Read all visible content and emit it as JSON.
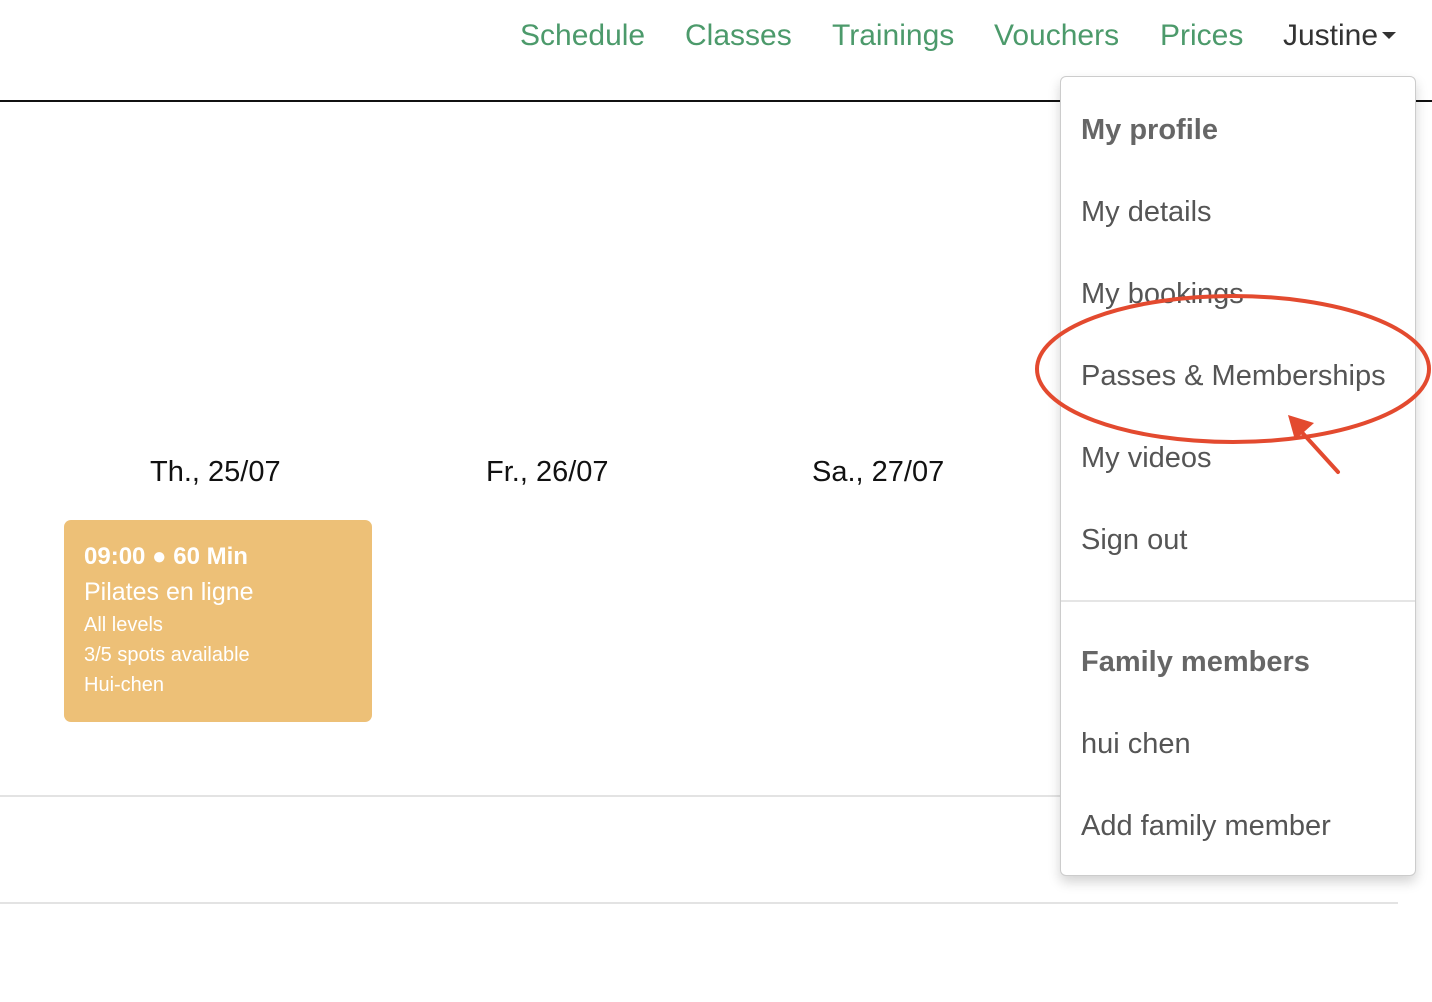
{
  "nav": {
    "links": [
      {
        "label": "Schedule"
      },
      {
        "label": "Classes"
      },
      {
        "label": "Trainings"
      },
      {
        "label": "Vouchers"
      },
      {
        "label": "Prices"
      }
    ],
    "user": "Justine",
    "link_color": "#4c9a6b"
  },
  "schedule": {
    "days": [
      "Th., 25/07",
      "Fr., 26/07",
      "Sa., 27/07"
    ],
    "card": {
      "time": "09:00 ● 60 Min",
      "title": "Pilates en ligne",
      "level": "All levels",
      "spots": "3/5 spots available",
      "instructor": "Hui-chen",
      "color": "#edc077"
    }
  },
  "dropdown": {
    "profile_header": "My profile",
    "profile_items": [
      "My details",
      "My bookings",
      "Passes & Memberships",
      "My videos",
      "Sign out"
    ],
    "family_header": "Family members",
    "family_items": [
      "hui chen",
      "Add family member"
    ]
  },
  "annotation": {
    "highlight_color": "#e34a2f",
    "target": "Passes & Memberships",
    "icons": [
      "ellipse-highlight",
      "arrow-pointer-icon"
    ]
  }
}
